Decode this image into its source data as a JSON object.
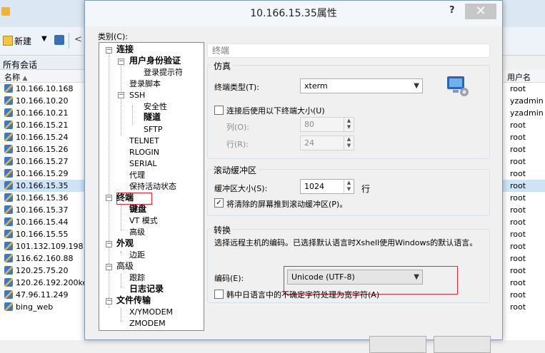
{
  "background": {
    "toolbar": {
      "new_label": "新建"
    },
    "sessions_header": "所有会话",
    "col_name": "名称",
    "col_user": "用户名",
    "sessions": [
      {
        "name": "10.166.10.168",
        "user": "root"
      },
      {
        "name": "10.166.10.20",
        "user": "yzadmin"
      },
      {
        "name": "10.166.10.21",
        "user": "yzadmin"
      },
      {
        "name": "10.166.15.21",
        "user": "root"
      },
      {
        "name": "10.166.15.24",
        "user": "root"
      },
      {
        "name": "10.166.15.26",
        "user": "root"
      },
      {
        "name": "10.166.15.27",
        "user": "root"
      },
      {
        "name": "10.166.15.29",
        "user": "root"
      },
      {
        "name": "10.166.15.35",
        "user": "root",
        "selected": true
      },
      {
        "name": "10.166.15.36",
        "user": "root"
      },
      {
        "name": "10.166.15.37",
        "user": "root"
      },
      {
        "name": "10.166.15.44",
        "user": "root"
      },
      {
        "name": "10.166.15.55",
        "user": "root"
      },
      {
        "name": "101.132.109.198",
        "user": "root"
      },
      {
        "name": "116.62.160.88",
        "user": "root"
      },
      {
        "name": "120.25.75.20",
        "user": "root"
      },
      {
        "name": "120.26.192.200keh",
        "user": "root"
      },
      {
        "name": "47.96.11.249",
        "user": "root"
      },
      {
        "name": "bing_web",
        "user": "root"
      }
    ]
  },
  "dialog": {
    "title": "10.166.15.35属性",
    "help": "?",
    "close": "✕",
    "category_label": "类别(C):",
    "tree": {
      "connect": "连接",
      "user_auth": "用户身份验证",
      "login_prompt": "登录提示符",
      "login_script": "登录脚本",
      "ssh": "SSH",
      "security": "安全性",
      "tunnel": "隧道",
      "sftp": "SFTP",
      "telnet": "TELNET",
      "rlogin": "RLOGIN",
      "serial": "SERIAL",
      "proxy": "代理",
      "keepalive": "保持活动状态",
      "terminal": "终端",
      "keyboard": "键盘",
      "vt_mode": "VT 模式",
      "advanced1": "高级",
      "appearance": "外观",
      "margin": "边距",
      "advanced2": "高级",
      "trace": "跟踪",
      "logging": "日志记录",
      "file_transfer": "文件传输",
      "xymodem": "X/YMODEM",
      "zmodem": "ZMODEM"
    },
    "panel": {
      "header": "终端",
      "emulation": {
        "group": "仿真",
        "terminal_type_label": "终端类型(T):",
        "terminal_type_value": "xterm",
        "resize_label": "连接后使用以下终端大小(U)",
        "cols_label": "列(O):",
        "cols_value": "80",
        "rows_label": "行(R):",
        "rows_value": "24"
      },
      "scroll": {
        "group": "滚动缓冲区",
        "size_label": "缓冲区大小(S):",
        "size_value": "1024",
        "unit": "行",
        "push_label": "将清除的屏幕推到滚动缓冲区(P)。"
      },
      "convert": {
        "group": "转换",
        "desc": "选择远程主机的编码。已选择默认语言时Xshell使用Windows的默认语言。",
        "encoding_label": "编码(E):",
        "encoding_value": "Unicode (UTF-8)",
        "cjk_label": "韩中日语言中的不确定字符处理为宽字符(A)"
      }
    }
  }
}
